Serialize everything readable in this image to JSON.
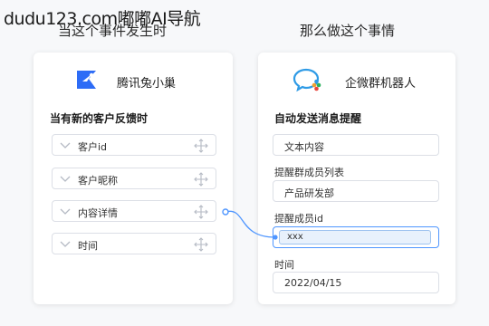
{
  "watermark": "dudu123.com嘟嘟AI导航",
  "trigger": {
    "title": "当这个事件发生时",
    "app_name": "腾讯兔小巢",
    "app_icon": "tuxiaochao-logo-icon",
    "section_title": "当有新的客户反馈时",
    "fields": [
      {
        "label": "客户id"
      },
      {
        "label": "客户昵称"
      },
      {
        "label": "内容详情"
      },
      {
        "label": "时间"
      }
    ]
  },
  "action": {
    "title": "那么做这个事情",
    "app_name": "企微群机器人",
    "app_icon": "wecom-robot-logo-icon",
    "section_title": "自动发送消息提醒",
    "message_type_value": "文本内容",
    "member_list_label": "提醒群成员列表",
    "member_list_value": "产品研发部",
    "member_id_label": "提醒成员id",
    "member_id_value": "xxx",
    "time_label": "时间",
    "time_value": "2022/04/15"
  },
  "colors": {
    "accent_blue": "#4f96ff",
    "tuxiaochao_blue": "#2d6cf6",
    "wecom_green": "#2bb15e"
  }
}
